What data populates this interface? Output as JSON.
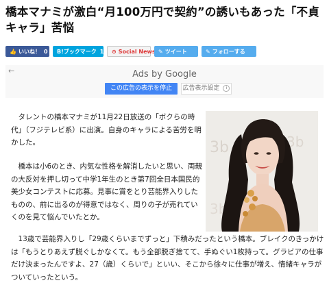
{
  "article": {
    "headline_line1": "橋本マナミが激白“月100万円で契約”の誘いもあった「不貞",
    "headline_line2": "キャラ」苦悩",
    "paragraphs": [
      "タレントの橋本マナミが11月22日放送の「ボクらの時代」（フジテレビ系）に出演。自身のキャラによる苦労を明かした。",
      "橋本は小6のとき、内気な性格を解消したいと思い、両親の大反対を押し切って中学1年生のとき第7回全日本国民的美少女コンテストに応募。見事に賞をとり芸能界入りしたものの、前に出るのが得意ではなく、周りの子が売れていくのを見て悩んでいたとか。",
      "13歳で芸能界入りし「29歳くらいまでずっと」下積みだったという橋本。ブレイクのきっかけは「もうとりあえず脱ぐしかなくて。もう全部脱ぎ捨てて、手ぬぐい1枚持って。グラビアの仕事だけ決まったんですよ、27（歳）くらいで」といい、そこから徐々に仕事が増え、情緒キャラがついていったという。"
    ]
  },
  "share": {
    "like_label": "いいね！",
    "like_count": "0",
    "hatena_label": "B!ブックマーク",
    "hatena_count": "1",
    "social_news_label": "Social News",
    "tweet_label": "ツイート",
    "follow_label": "フォローする"
  },
  "ad": {
    "ads_by": "Ads by Google",
    "stop_label": "この広告の表示を停止",
    "why_label": "広告表示設定"
  },
  "colors": {
    "facebook": "#3b5998",
    "hatena": "#00a4de",
    "twitter": "#55acee",
    "google_blue": "#4285f4"
  }
}
